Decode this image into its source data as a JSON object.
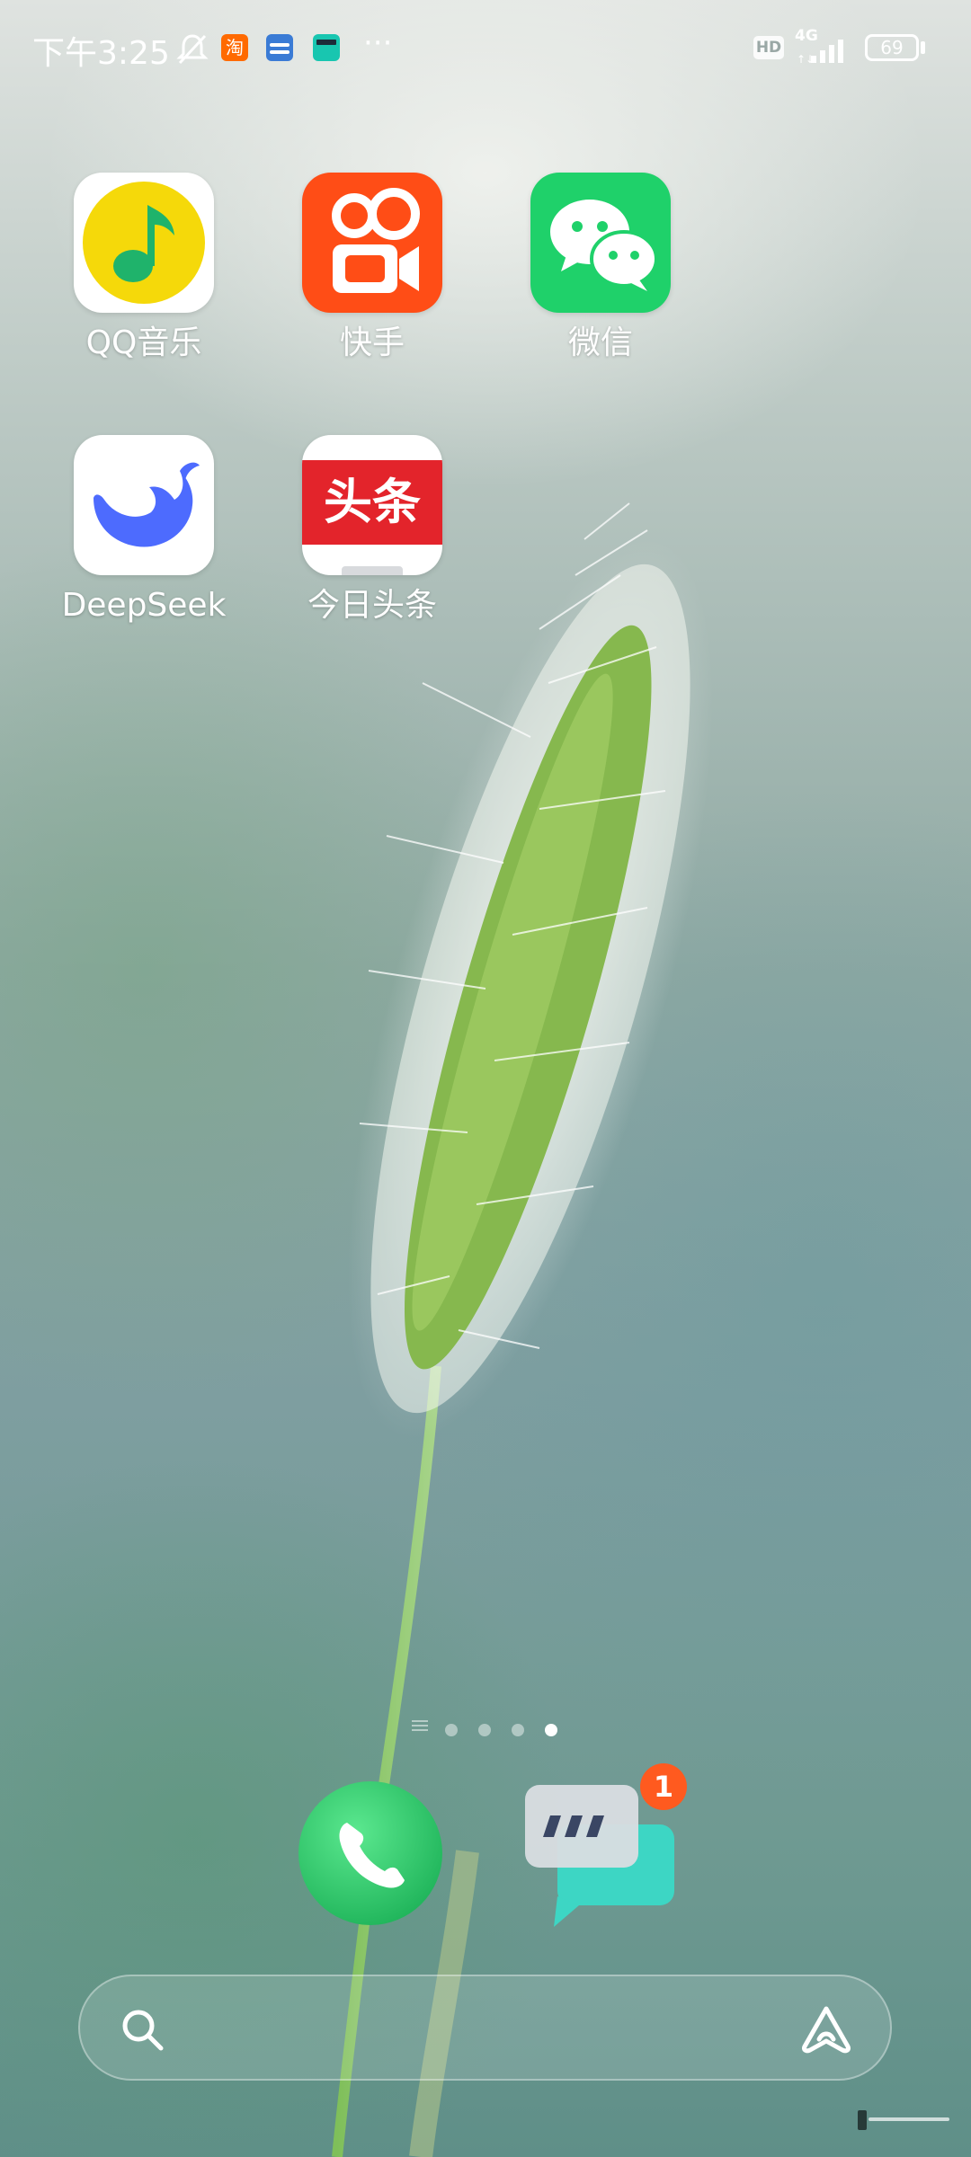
{
  "status_bar": {
    "time": "下午3:25",
    "notification_icons": [
      "bell-muted-icon",
      "taobao-icon",
      "wallet-icon",
      "video-clapper-icon"
    ],
    "more": "···",
    "hd": "HD",
    "network": "4G",
    "battery": "69"
  },
  "apps": [
    {
      "label": "QQ音乐",
      "icon": "qq-music-icon"
    },
    {
      "label": "快手",
      "icon": "kuaishou-icon"
    },
    {
      "label": "微信",
      "icon": "wechat-icon"
    },
    {
      "label": "DeepSeek",
      "icon": "deepseek-icon"
    },
    {
      "label": "今日头条",
      "icon": "toutiao-icon",
      "icon_text": "头条"
    }
  ],
  "page_indicator": {
    "count": 4,
    "active": 4
  },
  "dock": [
    {
      "icon": "phone-icon"
    },
    {
      "icon": "messages-icon",
      "badge": "1"
    }
  ],
  "search": {
    "placeholder": ""
  },
  "colors": {
    "qq_music_bg": "#ffffff",
    "qq_music_yellow": "#f5d90a",
    "qq_music_green": "#1fb36b",
    "kuaishou": "#ff4d16",
    "wechat": "#1fd16a",
    "deepseek_blue": "#4d6bfe",
    "toutiao_red": "#e3242b",
    "phone_green": "#2fd46d",
    "badge_orange": "#ff5a1f"
  }
}
